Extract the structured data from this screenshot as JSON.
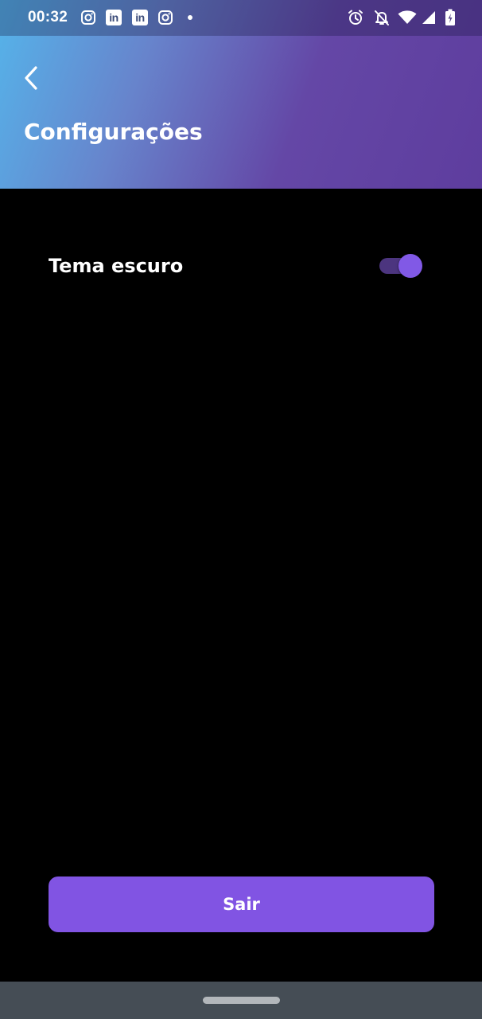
{
  "status_bar": {
    "time": "00:32",
    "notification_icons": [
      "instagram-icon",
      "linkedin-icon",
      "linkedin-icon",
      "instagram-icon",
      "dot-icon"
    ],
    "system_icons": [
      "alarm-icon",
      "notifications-off-icon",
      "wifi-icon",
      "signal-icon",
      "battery-charging-icon"
    ],
    "linkedin_glyph": "in"
  },
  "header": {
    "back_icon": "chevron-left-icon",
    "title": "Configurações",
    "gradient": [
      "#55b4ea",
      "#6784cc",
      "#6447a6",
      "#5e3d9e"
    ]
  },
  "settings": {
    "dark_theme": {
      "label": "Tema escuro",
      "enabled": true
    }
  },
  "footer": {
    "logout_label": "Sair"
  },
  "colors": {
    "background": "#000000",
    "accent": "#8154e3",
    "toggle_thumb": "#8159e6",
    "toggle_track": "#4c357f",
    "nav_bar": "#454d55"
  }
}
